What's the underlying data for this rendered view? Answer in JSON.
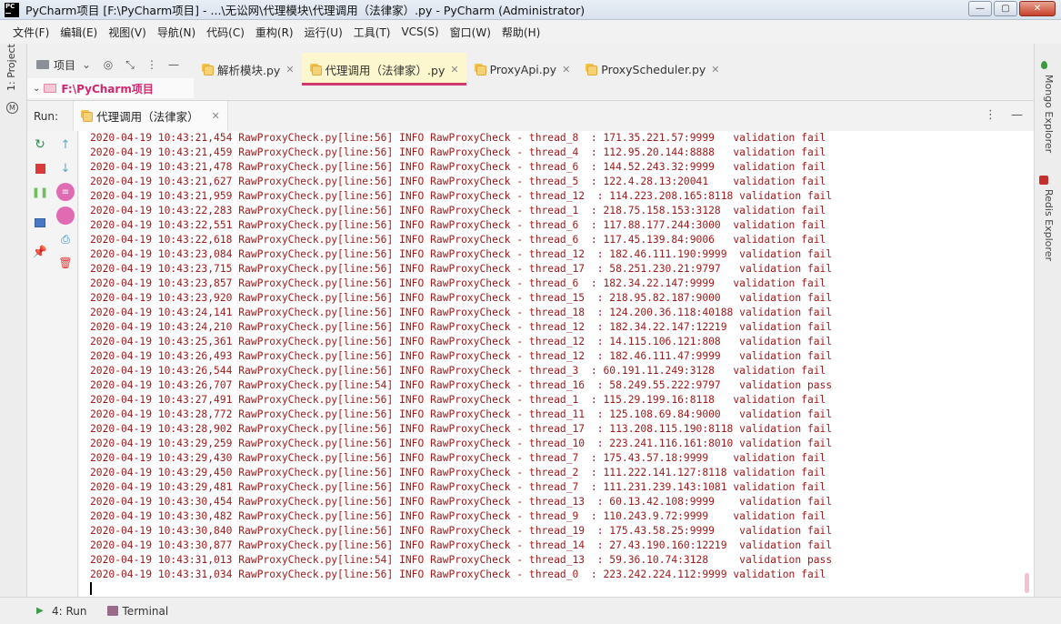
{
  "window": {
    "title": "PyCharm项目 [F:\\PyCharm项目] - ...\\无讼网\\代理模块\\代理调用（法律家）.py - PyCharm (Administrator)",
    "logo_text": "PC",
    "minimize": "—",
    "maximize": "▢",
    "close": "✕"
  },
  "menu": [
    "文件(F)",
    "编辑(E)",
    "视图(V)",
    "导航(N)",
    "代码(C)",
    "重构(R)",
    "运行(U)",
    "工具(T)",
    "VCS(S)",
    "窗口(W)",
    "帮助(H)"
  ],
  "left_stripe": {
    "project_tab": "1: Project"
  },
  "project_panel": {
    "label": "项目",
    "root_folder": "F:\\PyCharm项目"
  },
  "editor_tabs": [
    {
      "label": "解析模块.py",
      "active": false
    },
    {
      "label": "代理调用（法律家）.py",
      "active": true
    },
    {
      "label": "ProxyApi.py",
      "active": false
    },
    {
      "label": "ProxyScheduler.py",
      "active": false
    }
  ],
  "right_stripe": {
    "mongo": "Mongo Explorer",
    "redis": "Redis Explorer"
  },
  "run_panel": {
    "title": "Run:",
    "tab_label": "代理调用（法律家）",
    "more_icon": "⋮",
    "minimize_icon": "—"
  },
  "console": {
    "lines": [
      "2020-04-19 10:43:21,454 RawProxyCheck.py[line:56] INFO RawProxyCheck - thread_8  : 171.35.221.57:9999   validation fail",
      "2020-04-19 10:43:21,459 RawProxyCheck.py[line:56] INFO RawProxyCheck - thread_4  : 112.95.20.144:8888   validation fail",
      "2020-04-19 10:43:21,478 RawProxyCheck.py[line:56] INFO RawProxyCheck - thread_6  : 144.52.243.32:9999   validation fail",
      "2020-04-19 10:43:21,627 RawProxyCheck.py[line:56] INFO RawProxyCheck - thread_5  : 122.4.28.13:20041    validation fail",
      "2020-04-19 10:43:21,959 RawProxyCheck.py[line:56] INFO RawProxyCheck - thread_12  : 114.223.208.165:8118 validation fail",
      "2020-04-19 10:43:22,283 RawProxyCheck.py[line:56] INFO RawProxyCheck - thread_1  : 218.75.158.153:3128  validation fail",
      "2020-04-19 10:43:22,551 RawProxyCheck.py[line:56] INFO RawProxyCheck - thread_6  : 117.88.177.244:3000  validation fail",
      "2020-04-19 10:43:22,618 RawProxyCheck.py[line:56] INFO RawProxyCheck - thread_6  : 117.45.139.84:9006   validation fail",
      "2020-04-19 10:43:23,084 RawProxyCheck.py[line:56] INFO RawProxyCheck - thread_12  : 182.46.111.190:9999  validation fail",
      "2020-04-19 10:43:23,715 RawProxyCheck.py[line:56] INFO RawProxyCheck - thread_17  : 58.251.230.21:9797   validation fail",
      "2020-04-19 10:43:23,857 RawProxyCheck.py[line:56] INFO RawProxyCheck - thread_6  : 182.34.22.147:9999   validation fail",
      "2020-04-19 10:43:23,920 RawProxyCheck.py[line:56] INFO RawProxyCheck - thread_15  : 218.95.82.187:9000   validation fail",
      "2020-04-19 10:43:24,141 RawProxyCheck.py[line:56] INFO RawProxyCheck - thread_18  : 124.200.36.118:40188 validation fail",
      "2020-04-19 10:43:24,210 RawProxyCheck.py[line:56] INFO RawProxyCheck - thread_12  : 182.34.22.147:12219  validation fail",
      "2020-04-19 10:43:25,361 RawProxyCheck.py[line:56] INFO RawProxyCheck - thread_12  : 14.115.106.121:808   validation fail",
      "2020-04-19 10:43:26,493 RawProxyCheck.py[line:56] INFO RawProxyCheck - thread_12  : 182.46.111.47:9999   validation fail",
      "2020-04-19 10:43:26,544 RawProxyCheck.py[line:56] INFO RawProxyCheck - thread_3  : 60.191.11.249:3128   validation fail",
      "2020-04-19 10:43:26,707 RawProxyCheck.py[line:54] INFO RawProxyCheck - thread_16  : 58.249.55.222:9797   validation pass",
      "2020-04-19 10:43:27,491 RawProxyCheck.py[line:56] INFO RawProxyCheck - thread_1  : 115.29.199.16:8118   validation fail",
      "2020-04-19 10:43:28,772 RawProxyCheck.py[line:56] INFO RawProxyCheck - thread_11  : 125.108.69.84:9000   validation fail",
      "2020-04-19 10:43:28,902 RawProxyCheck.py[line:56] INFO RawProxyCheck - thread_17  : 113.208.115.190:8118 validation fail",
      "2020-04-19 10:43:29,259 RawProxyCheck.py[line:56] INFO RawProxyCheck - thread_10  : 223.241.116.161:8010 validation fail",
      "2020-04-19 10:43:29,430 RawProxyCheck.py[line:56] INFO RawProxyCheck - thread_7  : 175.43.57.18:9999    validation fail",
      "2020-04-19 10:43:29,450 RawProxyCheck.py[line:56] INFO RawProxyCheck - thread_2  : 111.222.141.127:8118 validation fail",
      "2020-04-19 10:43:29,481 RawProxyCheck.py[line:56] INFO RawProxyCheck - thread_7  : 111.231.239.143:1081 validation fail",
      "2020-04-19 10:43:30,454 RawProxyCheck.py[line:56] INFO RawProxyCheck - thread_13  : 60.13.42.108:9999    validation fail",
      "2020-04-19 10:43:30,482 RawProxyCheck.py[line:56] INFO RawProxyCheck - thread_9  : 110.243.9.72:9999    validation fail",
      "2020-04-19 10:43:30,840 RawProxyCheck.py[line:56] INFO RawProxyCheck - thread_19  : 175.43.58.25:9999    validation fail",
      "2020-04-19 10:43:30,877 RawProxyCheck.py[line:56] INFO RawProxyCheck - thread_14  : 27.43.190.160:12219  validation fail",
      "2020-04-19 10:43:31,013 RawProxyCheck.py[line:54] INFO RawProxyCheck - thread_13  : 59.36.10.74:3128     validation pass",
      "2020-04-19 10:43:31,034 RawProxyCheck.py[line:56] INFO RawProxyCheck - thread_0  : 223.242.224.112:9999 validation fail"
    ]
  },
  "bottom_tabs": [
    {
      "label": "4: Run"
    },
    {
      "label": "Terminal"
    }
  ],
  "colors": {
    "log_text": "#a11a1a",
    "active_tab_bg": "#fdf7d0",
    "active_tab_underline": "#d0386e",
    "root_folder_text": "#d02870"
  }
}
